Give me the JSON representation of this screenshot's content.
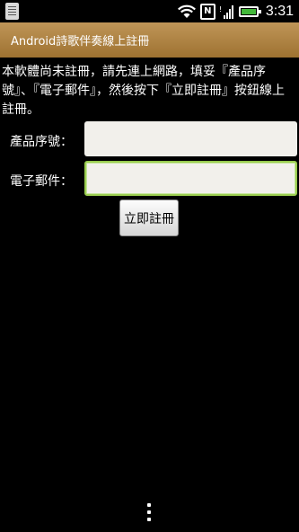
{
  "status_bar": {
    "icons": [
      "notification-icon",
      "wifi-icon",
      "nfc-icon",
      "signal-icon",
      "battery-icon"
    ],
    "nfc_glyph": "N",
    "time": "3:31"
  },
  "app": {
    "title": "Android詩歌伴奏線上註冊",
    "accent_color": "#b2874a"
  },
  "notice_text": "本軟體尚未註冊，請先連上網路，填妥『產品序號』、『電子郵件』，然後按下『立即註冊』按鈕線上註冊。",
  "form": {
    "serial_label": "產品序號：",
    "serial_value": "",
    "email_label": "電子郵件：",
    "email_value": "",
    "register_button": "立即註冊"
  },
  "menu_icon": "overflow-menu-icon"
}
